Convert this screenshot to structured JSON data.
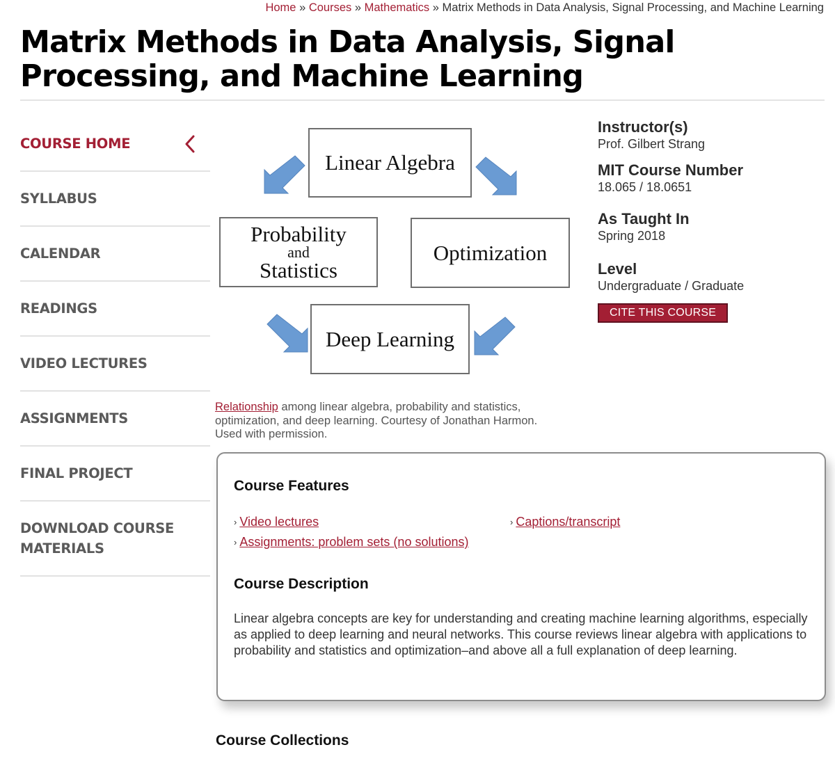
{
  "breadcrumb": {
    "items": [
      {
        "label": "Home",
        "link": true
      },
      {
        "label": "Courses",
        "link": true
      },
      {
        "label": "Mathematics",
        "link": true
      },
      {
        "label": "Matrix Methods in Data Analysis, Signal Processing, and Machine Learning",
        "link": false
      }
    ],
    "separator": "»"
  },
  "page_title": "Matrix Methods in Data Analysis, Signal Processing, and Machine Learning",
  "sidebar": {
    "items": [
      {
        "label": "COURSE HOME",
        "active": true
      },
      {
        "label": "SYLLABUS"
      },
      {
        "label": "CALENDAR"
      },
      {
        "label": "READINGS"
      },
      {
        "label": "VIDEO LECTURES"
      },
      {
        "label": "ASSIGNMENTS"
      },
      {
        "label": "FINAL PROJECT"
      },
      {
        "label": "DOWNLOAD COURSE MATERIALS"
      }
    ],
    "collapse_icon": "chevron-left-icon"
  },
  "colors": {
    "accent": "#a31f34",
    "arrow_blue": "#6a9bd3",
    "nav_text": "#5a5a5a"
  },
  "diagram": {
    "boxes": {
      "top": "Linear Algebra",
      "left_line1": "Probability",
      "left_line2": "and",
      "left_line3": "Statistics",
      "right": "Optimization",
      "bottom": "Deep Learning"
    }
  },
  "caption": {
    "link_text": "Relationship",
    "text": " among linear algebra, probability and statistics, optimization, and deep learning. Courtesy of Jonathan Harmon. Used with permission."
  },
  "course_info": {
    "instructor_label": "Instructor(s)",
    "instructor": "Prof. Gilbert Strang",
    "number_label": "MIT Course Number",
    "number": "18.065 / 18.0651",
    "taught_label": "As Taught In",
    "taught": "Spring 2018",
    "level_label": "Level",
    "level": "Undergraduate / Graduate",
    "cite_button": "CITE THIS COURSE"
  },
  "features": {
    "heading": "Course Features",
    "marker": "›",
    "links": [
      "Video lectures",
      "Captions/transcript",
      "Assignments: problem sets (no solutions)"
    ]
  },
  "description": {
    "heading": "Course Description",
    "text": "Linear algebra concepts are key for understanding and creating machine learning algorithms, especially as applied to deep learning and neural networks. This course reviews linear algebra with applications to probability and statistics and optimization–and above all a full explanation of deep learning."
  },
  "collections": {
    "heading": "Course Collections"
  }
}
